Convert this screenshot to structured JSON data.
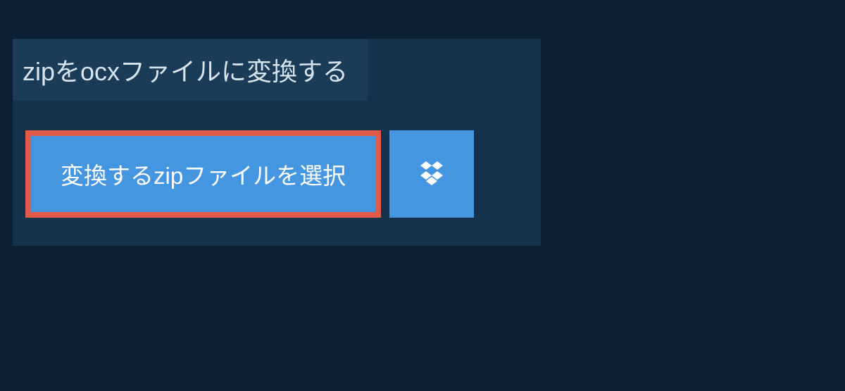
{
  "header": {
    "title": "zipをocxファイルに変換する"
  },
  "actions": {
    "select_file_label": "変換するzipファイルを選択"
  },
  "colors": {
    "page_bg": "#0d1f33",
    "panel_bg": "#15324d",
    "heading_bg": "#1b3c59",
    "button_bg": "#4596e0",
    "button_border": "#e25a4a",
    "text_light": "#d8e4ec",
    "text_white": "#ffffff"
  }
}
